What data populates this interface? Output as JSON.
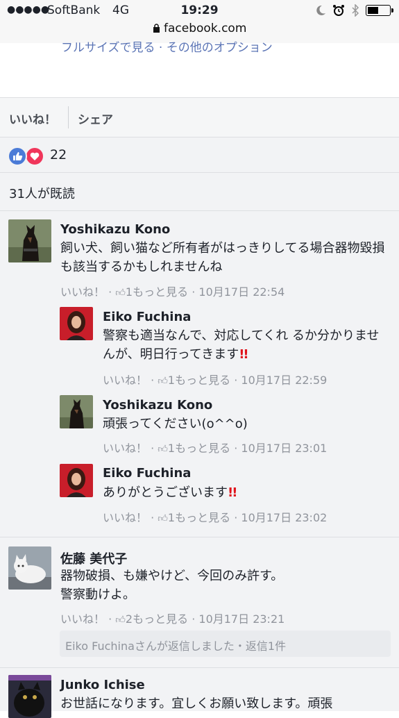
{
  "status": {
    "signal_dots": "●●●●●",
    "carrier": "SoftBank",
    "network": "4G",
    "time": "19:29",
    "url": "facebook.com"
  },
  "post": {
    "fullsize_link": "フルサイズで見る · その他のオプション",
    "like_action": "いいね！",
    "share_action": "シェア",
    "reaction_count": "22",
    "seen_count": "31人が既読"
  },
  "comments": [
    {
      "name": "Yoshikazu Kono",
      "text": "飼い犬、飼い猫など所有者がはっきりしてる場合器物毀損も該当するかもしれませんね",
      "like": "いいね！",
      "likes": "1",
      "more": "もっと見る",
      "time": "10月17日 22:54"
    },
    {
      "name": "Eiko Fuchina",
      "text": "警察も適当なんで、対応してくれ るか分かりませんが、明日行ってきます",
      "exclaim": "!!",
      "like": "いいね！",
      "likes": "1",
      "more": "もっと見る",
      "time": "10月17日 22:59"
    },
    {
      "name": "Yoshikazu Kono",
      "text": "頑張ってください(o^^o)",
      "like": "いいね！",
      "likes": "1",
      "more": "もっと見る",
      "time": "10月17日 23:01"
    },
    {
      "name": "Eiko Fuchina",
      "text": "ありがとうございます",
      "exclaim": "!!",
      "like": "いいね！",
      "likes": "1",
      "more": "もっと見る",
      "time": "10月17日 23:02"
    },
    {
      "name": "佐藤 美代子",
      "text_line1": "器物破損、も嫌やけど、今回のみ許す。",
      "text_line2": "警察動けよ。",
      "like": "いいね！",
      "likes": "2",
      "more": "もっと見る",
      "time": "10月17日 23:21",
      "reply_summary": "Eiko Fuchinaさんが返信しました・返信1件"
    },
    {
      "name": "Junko Ichise",
      "text": "お世話になります。宜しくお願い致します。頑張"
    }
  ],
  "colors": {
    "link_blue": "#4a66ad",
    "meta_grey": "#90949c",
    "like_blue": "#4b7bd7",
    "love_red": "#f0365b",
    "exclaim_red": "#e0131b"
  }
}
